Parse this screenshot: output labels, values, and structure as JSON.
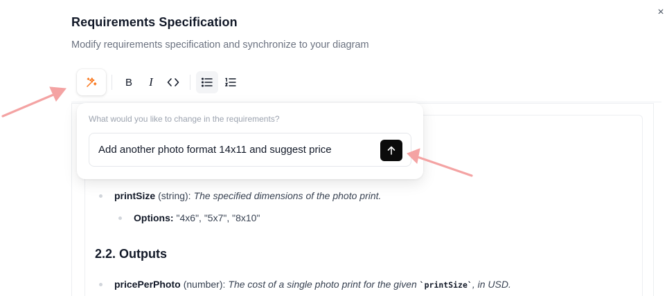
{
  "dialog": {
    "title": "Requirements Specification",
    "subtitle": "Modify requirements specification and synchronize to your diagram",
    "close_glyph": "×"
  },
  "toolbar": {
    "ai_icon": "sparkle-magic-icon",
    "bold_icon": "B",
    "italic_icon": "I",
    "code_icon": "<>",
    "bullet_list_icon": "bullet-list-icon",
    "ordered_list_icon": "ordered-list-icon",
    "accent_color": "#f97316"
  },
  "ai_popup": {
    "label": "What would you like to change in the requirements?",
    "value": "Add another photo format 14x11 and suggest price",
    "send_icon": "arrow-up-icon"
  },
  "document": {
    "input_item": {
      "name": "printSize",
      "type": "(string):",
      "description": "The specified dimensions of the photo print."
    },
    "options": {
      "label": "Options:",
      "values": "\"4x6\", \"5x7\", \"8x10\""
    },
    "outputs_heading": "2.2. Outputs",
    "output_item": {
      "name": "pricePerPhoto",
      "type": "(number):",
      "desc_before": "The cost of a single photo print for the given ",
      "code": "`printSize`",
      "desc_after": ", in USD."
    }
  },
  "annotations": {
    "arrow_color": "#f4a3a3"
  }
}
